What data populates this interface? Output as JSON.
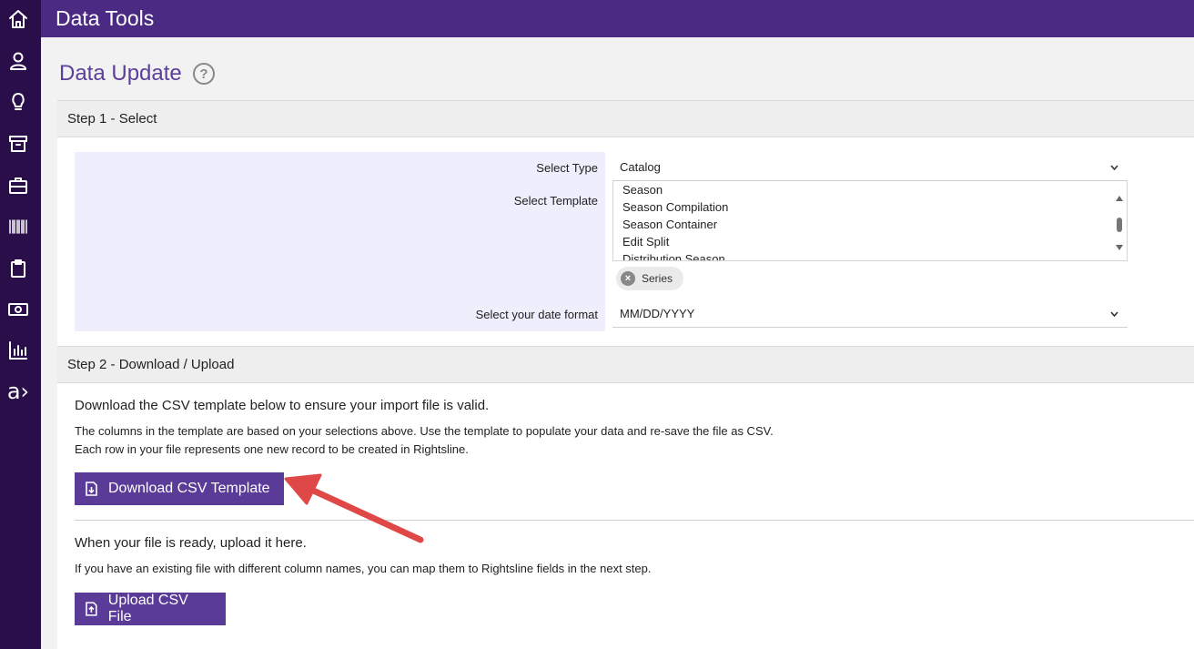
{
  "app": {
    "title": "Data Tools"
  },
  "sidebar": {
    "items": [
      {
        "icon": "home-icon"
      },
      {
        "icon": "user-icon"
      },
      {
        "icon": "lightbulb-icon"
      },
      {
        "icon": "archive-icon"
      },
      {
        "icon": "briefcase-icon"
      },
      {
        "icon": "barcode-icon"
      },
      {
        "icon": "clipboard-icon"
      },
      {
        "icon": "money-icon"
      },
      {
        "icon": "chart-icon"
      },
      {
        "icon": "brand-logo-icon",
        "text": "a›"
      }
    ]
  },
  "page": {
    "title": "Data Update",
    "help_icon": "?"
  },
  "step1": {
    "header": "Step 1 - Select",
    "type_label": "Select Type",
    "type_value": "Catalog",
    "template_label": "Select Template",
    "template_options": [
      "Season",
      "Season Compilation",
      "Season Container",
      "Edit Split",
      "Distribution Season"
    ],
    "selected_chip": "Series",
    "date_label": "Select your date format",
    "date_value": "MM/DD/YYYY"
  },
  "step2": {
    "header": "Step 2 - Download / Upload",
    "download_intro": "Download the CSV template below to ensure your import file is valid.",
    "download_note1": "The columns in the template are based on your selections above. Use the template to populate your data and re-save the file as CSV.",
    "download_note2": "Each row in your file represents one new record to be created in Rightsline.",
    "download_button": "Download CSV Template",
    "upload_intro": "When your file is ready, upload it here.",
    "upload_note": "If you have an existing file with different column names, you can map them to Rightsline fields in the next step.",
    "upload_button": "Upload CSV File"
  },
  "colors": {
    "sidebar": "#2a0e4a",
    "topbar": "#4a2a82",
    "accent": "#5a3c98",
    "annotation": "#e04848"
  }
}
